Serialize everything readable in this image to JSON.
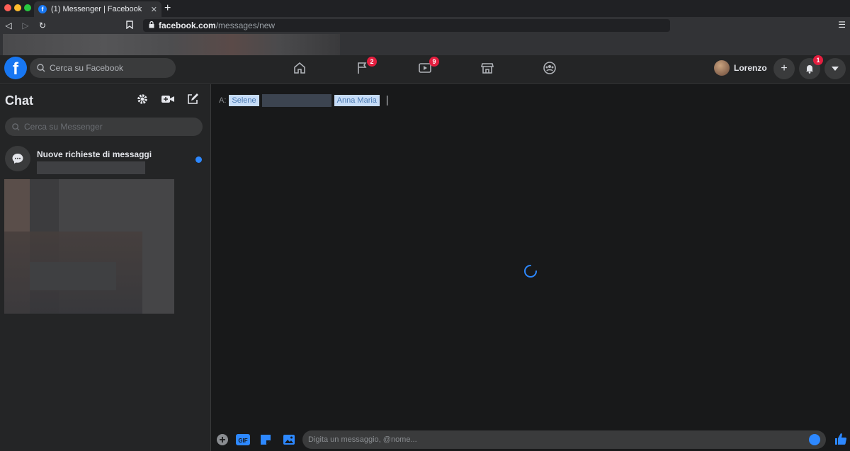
{
  "browser": {
    "tab_title": "(1) Messenger | Facebook",
    "tab_close": "✕",
    "new_tab": "+",
    "url_domain": "facebook.com",
    "url_path": "/messages/new",
    "traffic_colors": [
      "#ff5f57",
      "#febc2e",
      "#28c840"
    ]
  },
  "header": {
    "search_placeholder": "Cerca su Facebook",
    "nav": [
      {
        "name": "home-icon"
      },
      {
        "name": "pages-flag-icon",
        "badge": "2"
      },
      {
        "name": "watch-icon",
        "badge": "9"
      },
      {
        "name": "marketplace-icon"
      },
      {
        "name": "groups-icon"
      }
    ],
    "profile_name": "Lorenzo",
    "notifications_badge": "1"
  },
  "sidebar": {
    "title": "Chat",
    "search_placeholder": "Cerca su Messenger",
    "requests_label": "Nuove richieste di messaggi"
  },
  "main": {
    "to_label": "A:",
    "recipients": [
      "Selene",
      "Anna Maria"
    ],
    "composer_placeholder": "Digita un messaggio, @nome..."
  },
  "colors": {
    "accent": "#2d88ff",
    "brand": "#1877f2",
    "badge": "#e41e3f"
  }
}
